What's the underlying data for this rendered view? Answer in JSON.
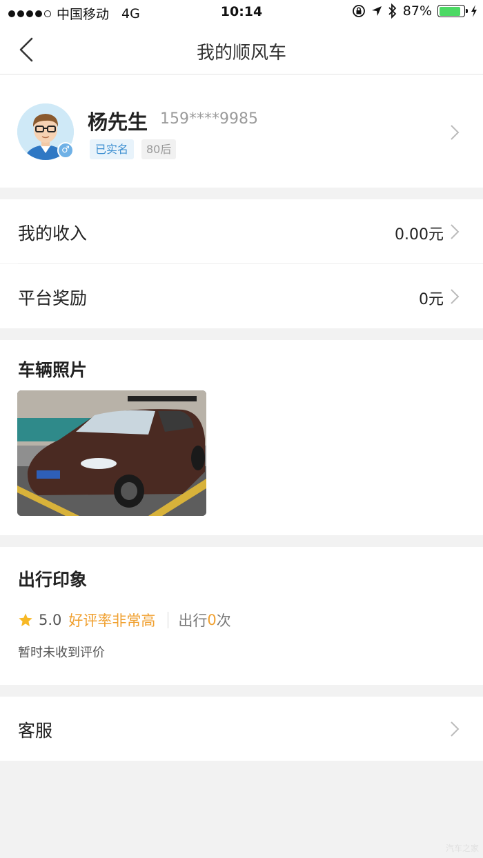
{
  "status_bar": {
    "carrier": "中国移动",
    "network": "4G",
    "time": "10:14",
    "battery_percent": "87%",
    "battery_level": 0.87,
    "icons": [
      "signal-dots-icon",
      "lock-rotation-icon",
      "location-arrow-icon",
      "bluetooth-icon",
      "battery-icon",
      "charging-icon"
    ]
  },
  "nav": {
    "title": "我的顺风车",
    "back_icon": "chevron-left-icon"
  },
  "profile": {
    "name": "杨先生",
    "phone": "159****9985",
    "tag_verified": "已实名",
    "tag_age": "80后",
    "gender": "♂",
    "avatar_icon": "avatar-male-glasses",
    "chevron_icon": "chevron-right-icon"
  },
  "finance": {
    "income_label": "我的收入",
    "income_value": "0.00元",
    "reward_label": "平台奖励",
    "reward_value": "0元"
  },
  "vehicle": {
    "title": "车辆照片",
    "photo_icon": "car-photo"
  },
  "impression": {
    "title": "出行印象",
    "rating": "5.0",
    "rating_text": "好评率非常高",
    "trips_prefix": "出行",
    "trips_count": "0",
    "trips_suffix": "次",
    "no_review": "暂时未收到评价",
    "star_icon": "star-icon"
  },
  "support": {
    "label": "客服"
  },
  "watermark": "汽车之家",
  "colors": {
    "accent_orange": "#f0a030",
    "verified_blue": "#3d8fd1",
    "battery_green": "#4cd964",
    "background_gray": "#f2f2f2"
  }
}
